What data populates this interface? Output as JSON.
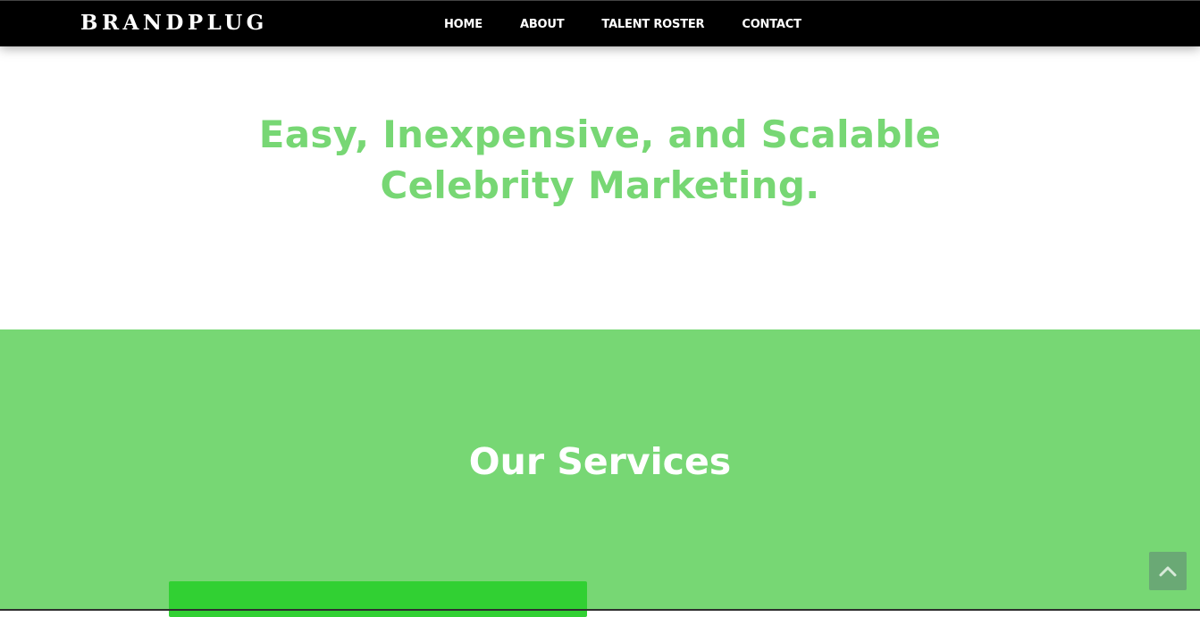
{
  "header": {
    "logo": "BRANDPLUG",
    "nav": [
      {
        "label": "HOME"
      },
      {
        "label": "ABOUT"
      },
      {
        "label": "TALENT ROSTER"
      },
      {
        "label": "CONTACT"
      }
    ]
  },
  "hero": {
    "title_line1": "Easy, Inexpensive, and Scalable",
    "title_line2": "Celebrity Marketing."
  },
  "services": {
    "title": "Our Services"
  },
  "icons": {
    "back_to_top": "chevron-up-icon"
  },
  "colors": {
    "nav_background": "#000000",
    "accent_green": "#77d774",
    "card_green": "#31d033",
    "back_to_top_button": "#6aa975"
  }
}
